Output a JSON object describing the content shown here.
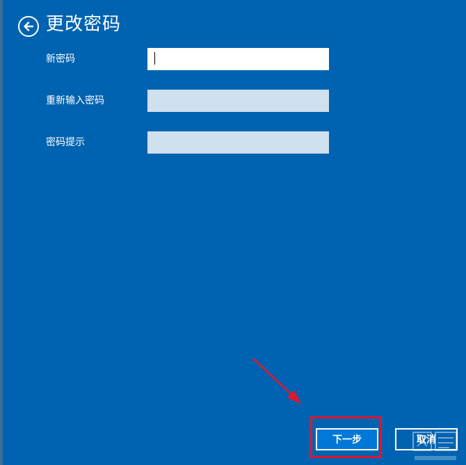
{
  "header": {
    "title": "更改密码"
  },
  "form": {
    "new_password_label": "新密码",
    "new_password_value": "",
    "reenter_password_label": "重新输入密码",
    "reenter_password_value": "",
    "hint_label": "密码提示",
    "hint_value": ""
  },
  "buttons": {
    "next_label": "下一步",
    "cancel_label": "取消"
  },
  "annotation": {
    "arrow_color": "#e3162b",
    "highlight_color": "#e3162b",
    "icon": "red-arrow-icon"
  },
  "watermark": {
    "icon": "watermark-logo-icon"
  },
  "colors": {
    "background": "#0063b1",
    "next_button": "#0078d7",
    "inactive_field": "#cfe0ee"
  }
}
